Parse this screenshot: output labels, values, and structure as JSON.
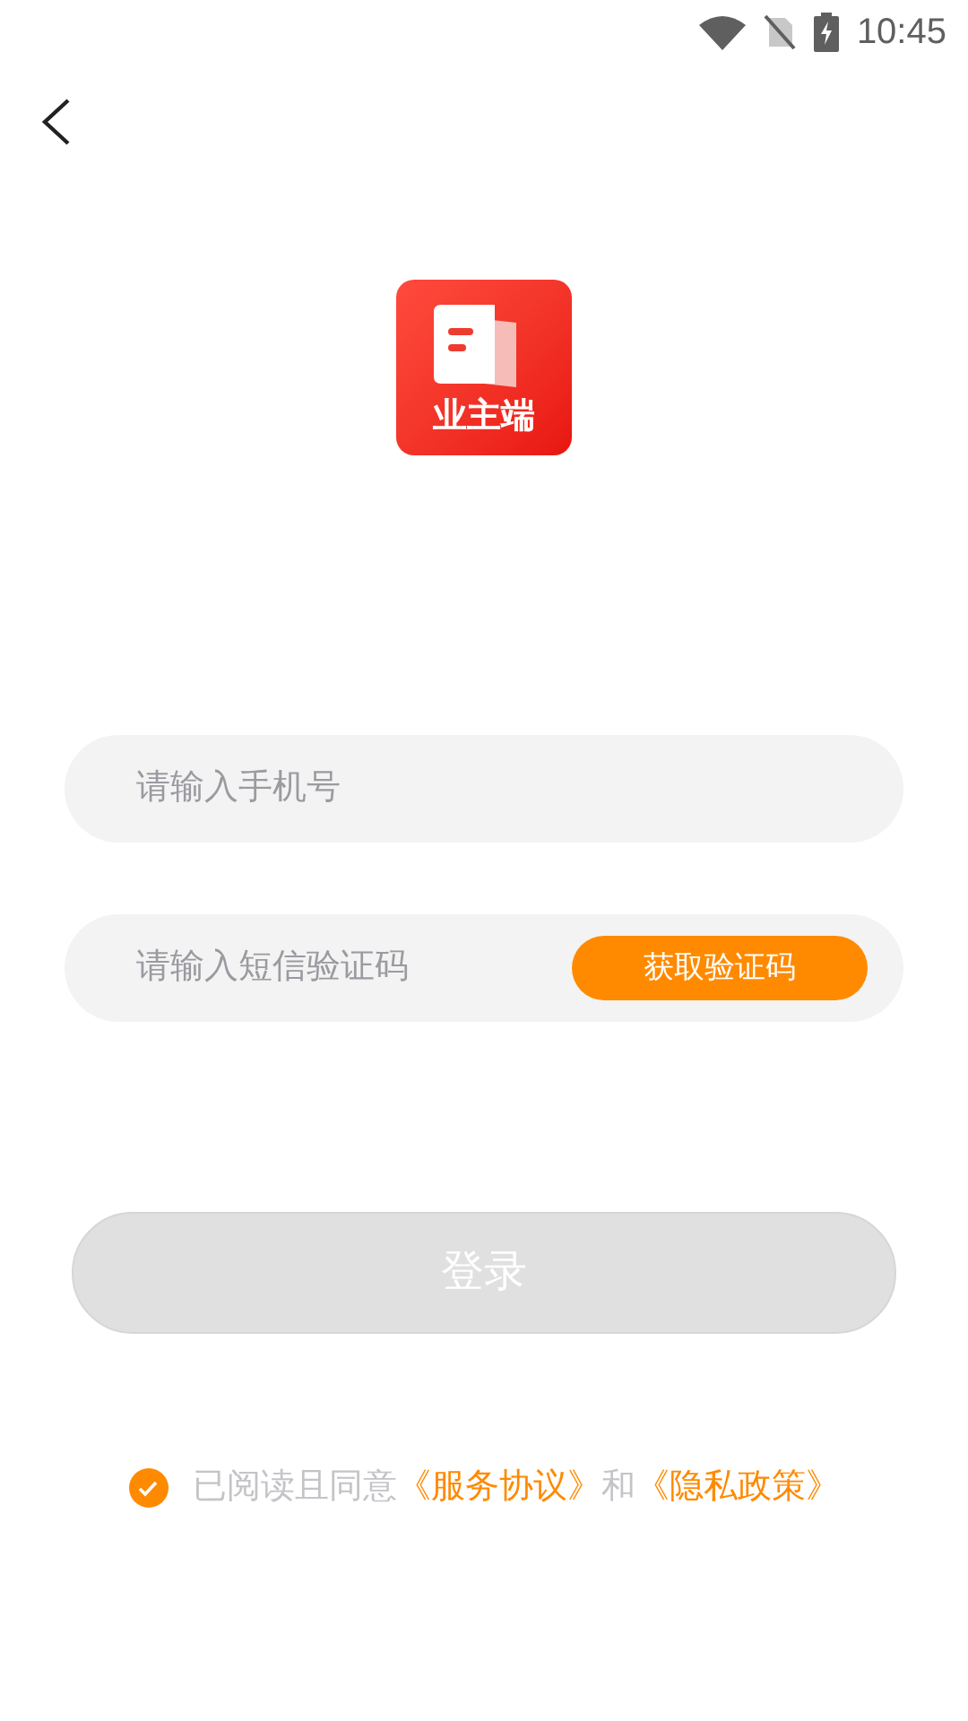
{
  "status_bar": {
    "time": "10:45"
  },
  "logo": {
    "label": "业主端"
  },
  "phone_field": {
    "placeholder": "请输入手机号"
  },
  "code_field": {
    "placeholder": "请输入短信验证码",
    "button": "获取验证码"
  },
  "login_button": {
    "label": "登录",
    "disabled": true
  },
  "agreement": {
    "checked": true,
    "prefix": "已阅读且同意",
    "links": [
      "《服务协议》",
      "《隐私政策》"
    ],
    "joiner": "和"
  }
}
